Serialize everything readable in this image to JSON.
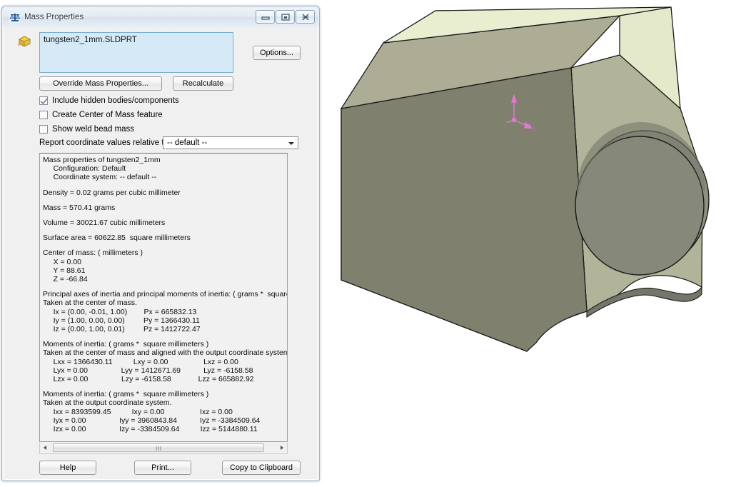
{
  "window": {
    "title": "Mass Properties",
    "icon": "scales-icon",
    "buttons": {
      "minimize": "minimize-icon",
      "maximize": "restore-icon",
      "close": "close-icon"
    }
  },
  "selection": {
    "icon": "part-icon",
    "value": "tungsten2_1mm.SLDPRT"
  },
  "toolbar": {
    "options_label": "Options...",
    "override_label": "Override Mass Properties...",
    "recalculate_label": "Recalculate"
  },
  "checkboxes": [
    {
      "label": "Include hidden bodies/components",
      "checked": true
    },
    {
      "label": "Create Center of Mass feature",
      "checked": false
    },
    {
      "label": "Show weld bead mass",
      "checked": false
    }
  ],
  "coordinate_combo": {
    "label": "Report coordinate values relative to:",
    "value": "-- default --",
    "options": [
      "-- default --"
    ]
  },
  "report": {
    "lines": [
      "Mass properties of tungsten2_1mm",
      "     Configuration: Default",
      "     Coordinate system: -- default --",
      "",
      "Density = 0.02 grams per cubic millimeter",
      "",
      "Mass = 570.41 grams",
      "",
      "Volume = 30021.67 cubic millimeters",
      "",
      "Surface area = 60622.85  square millimeters",
      "",
      "Center of mass: ( millimeters )",
      "     X = 0.00",
      "     Y = 88.61",
      "     Z = -66.84",
      "",
      "Principal axes of inertia and principal moments of inertia: ( grams *  square millimeters )",
      "Taken at the center of mass.",
      "     Ix = (0.00, -0.01, 1.00)        Px = 665832.13",
      "     Iy = (1.00, 0.00, 0.00)         Py = 1366430.11",
      "     Iz = (0.00, 1.00, 0.01)         Pz = 1412722.47",
      "",
      "Moments of inertia: ( grams *  square millimeters )",
      "Taken at the center of mass and aligned with the output coordinate system.",
      "     Lxx = 1366430.11          Lxy = 0.00                 Lxz = 0.00",
      "     Lyx = 0.00                Lyy = 1412671.69           Lyz = -6158.58",
      "     Lzx = 0.00                Lzy = -6158.58             Lzz = 665882.92",
      "",
      "Moments of inertia: ( grams *  square millimeters )",
      "Taken at the output coordinate system.",
      "     Ixx = 8393599.45          Ixy = 0.00                 Ixz = 0.00",
      "     Iyx = 0.00                Iyy = 3960843.84           Iyz = -3384509.64",
      "     Izx = 0.00                Izy = -3384509.64          Izz = 5144880.11"
    ]
  },
  "footer": {
    "help_label": "Help",
    "print_label": "Print...",
    "copy_label": "Copy to Clipboard"
  },
  "viewport": {
    "model_name": "tungsten2_1mm",
    "background_color": "#ffffff",
    "face_colors": {
      "front": "#80806f",
      "chamfer": "#adad95",
      "top": "#e9eed0",
      "right": "#b2b49a",
      "bore_inner": "#8a8c7c",
      "bore_face": "#868878",
      "edge": "#1a1a1a"
    },
    "origin_triad_color": "#e07ad0"
  }
}
